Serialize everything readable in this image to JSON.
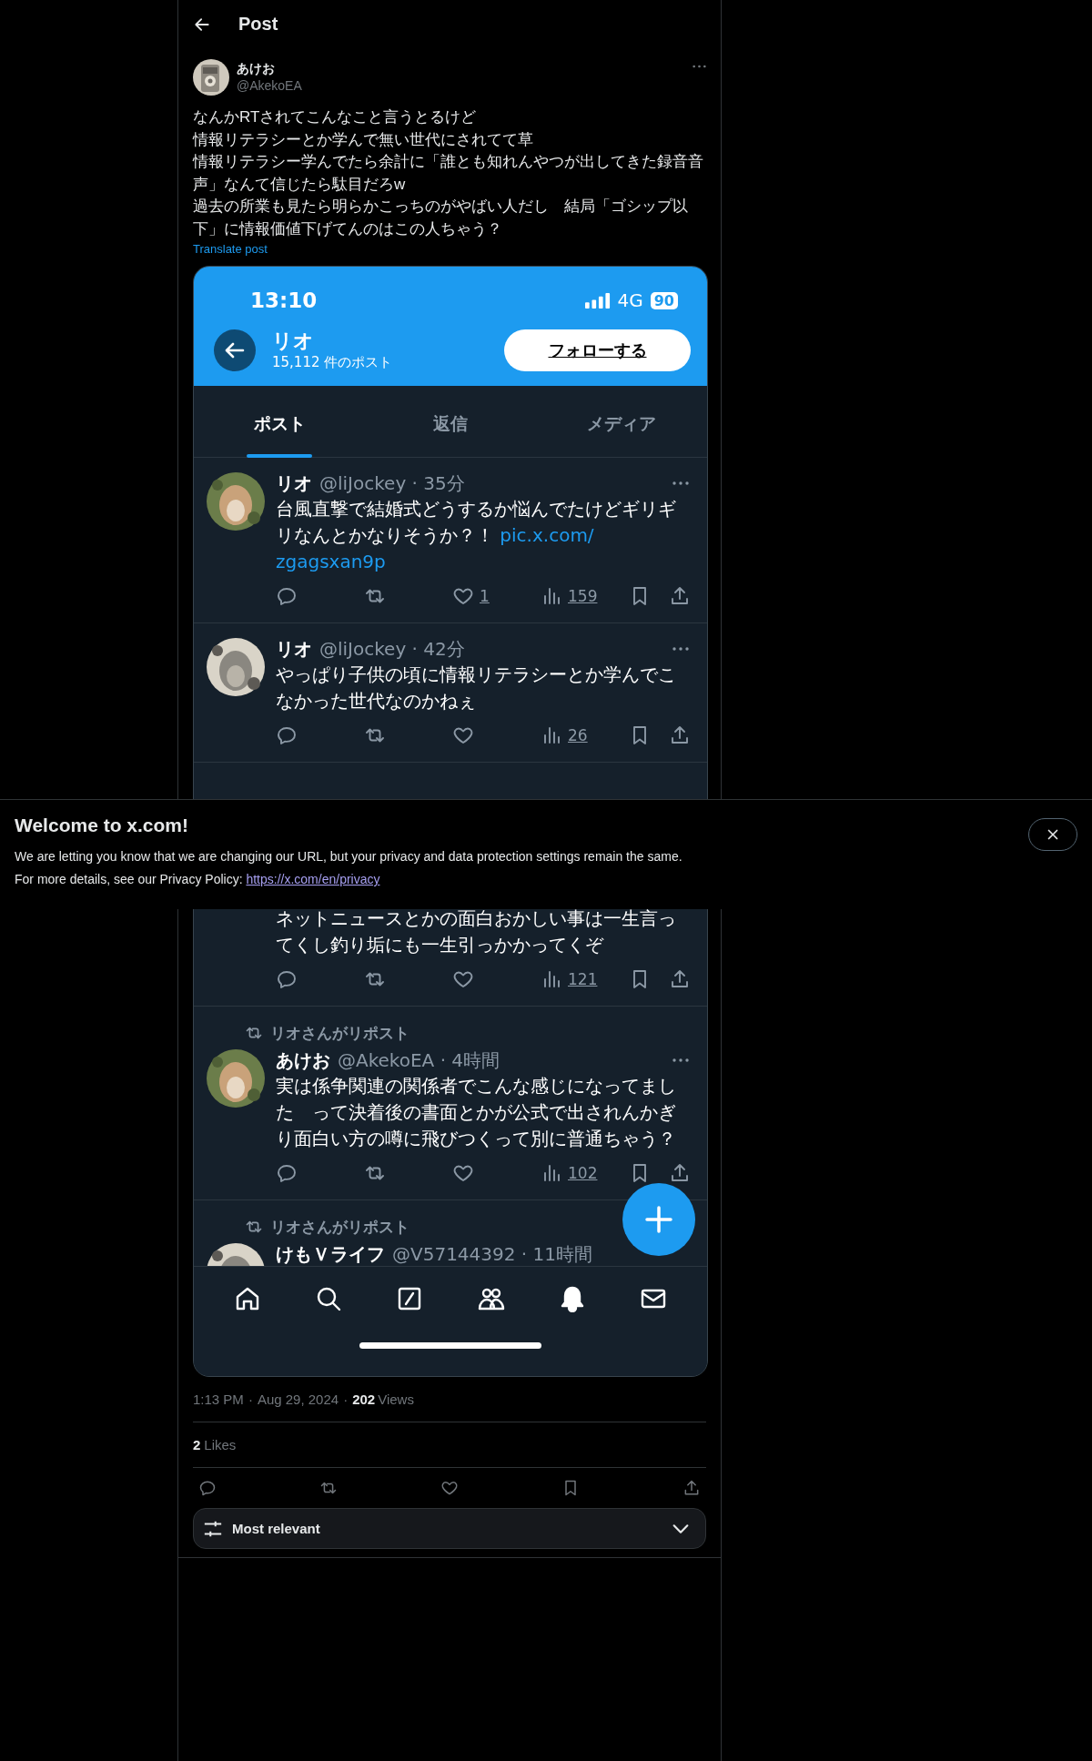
{
  "header": {
    "title": "Post"
  },
  "post": {
    "author": {
      "name": "あけお",
      "handle": "@AkekoEA"
    },
    "lines": [
      "なんかRTされてこんなこと言うとるけど",
      "情報リテラシーとか学んで無い世代にされてて草",
      "情報リテラシー学んでたら余計に「誰とも知れんやつが出してきた録音音声」なんて信じたら駄目だろw",
      "過去の所業も見たら明らかこっちのがやばい人だし　結局「ゴシップ以下」に情報価値下げてんのはこの人ちゃう？"
    ],
    "translate": "Translate post",
    "screenshot": {
      "status": {
        "time": "13:10",
        "network": "4G",
        "battery": "90"
      },
      "profile": {
        "name": "リオ",
        "post_count": "15,112 件のポスト",
        "follow_button": "フォローする"
      },
      "tabs": [
        {
          "label": "ポスト",
          "selected": true
        },
        {
          "label": "返信",
          "selected": false
        },
        {
          "label": "メディア",
          "selected": false
        }
      ],
      "posts": [
        {
          "kind": "post",
          "name": "リオ",
          "meta": "@liJockey · 35分",
          "text": "台風直撃で結婚式どうするか悩んでたけどギリギリなんとかなりそうか？！ ",
          "link": [
            "pic.x.com/",
            "zgagsxan9p"
          ],
          "likes": "1",
          "views": "159"
        },
        {
          "kind": "post",
          "name": "リオ",
          "meta": "@liJockey · 42分",
          "text": "やっぱり子供の頃に情報リテラシーとか学んでこなかった世代なのかねぇ",
          "views": "26"
        },
        {
          "kind": "covered",
          "text": "ネットニュースとかの面白おかしい事は一生言ってくし釣り垢にも一生引っかかってくぞ",
          "views": "121"
        },
        {
          "kind": "post",
          "repost": "リオさんがリポスト",
          "name": "あけお",
          "meta": "@AkekoEA · 4時間",
          "text": "実は係争関連の関係者でこんな感じになってました　って決着後の書面とかが公式で出されんかぎり面白い方の噂に飛びつくって別に普通ちゃう？",
          "views": "102"
        },
        {
          "kind": "cut",
          "repost": "リオさんがリポスト",
          "name": "けもＶライフ",
          "meta": "@V57144392 · 11時間"
        }
      ]
    },
    "stats": {
      "time": "1:13 PM",
      "separator_1": "·",
      "date": "Aug 29, 2024",
      "separator_2": "·",
      "views_count": "202",
      "views_label": "Views"
    },
    "likes": {
      "count": "2",
      "label": "Likes"
    },
    "sort": {
      "label": "Most relevant"
    }
  },
  "banner": {
    "title": "Welcome to x.com!",
    "text": "We are letting you know that we are changing our URL, but your privacy and data protection settings remain the same.",
    "policy_text": "For more details, see our Privacy Policy:",
    "policy_link": "https://x.com/en/privacy"
  }
}
